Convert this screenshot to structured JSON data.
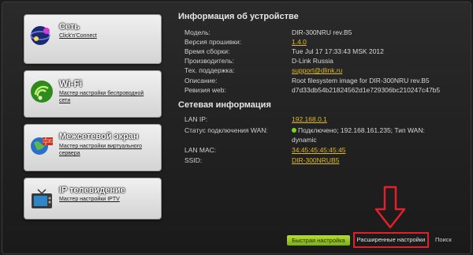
{
  "tiles": [
    {
      "title": "Сеть",
      "subtitle": "Click'n'Connect"
    },
    {
      "title": "Wi-Fi",
      "subtitle": "Мастер настройки беспроводной сети"
    },
    {
      "title": "Межсетевой экран",
      "subtitle": "Мастер настройки виртуального сервера"
    },
    {
      "title": "IP телевидение",
      "subtitle": "Мастер настройки IPTV"
    }
  ],
  "device_info": {
    "heading": "Информация об устройстве",
    "rows": [
      {
        "label": "Модель:",
        "value": "DIR-300NRU rev.B5"
      },
      {
        "label": "Версия прошивки:",
        "value": "1.4.0"
      },
      {
        "label": "Время сборки:",
        "value": "Tue Jul 17 17:33:43 MSK 2012"
      },
      {
        "label": "Производитель:",
        "value": "D-Link Russia"
      },
      {
        "label": "Тех. поддержка:",
        "value": "support@dlink.ru"
      },
      {
        "label": "Описание:",
        "value": "Root filesystem image for DIR-300NRU rev.B5"
      },
      {
        "label": "Ревизия web:",
        "value": "d7d33db54b21824562d1e729306bc210247c47b5"
      }
    ]
  },
  "network_info": {
    "heading": "Сетевая информация",
    "rows": [
      {
        "label": "LAN IP:",
        "value": "192.168.0.1"
      },
      {
        "label": "Статус подключения WAN:",
        "value": "Подключено; 192.168.161.235; Тип WAN:",
        "value2": "dynamic"
      },
      {
        "label": "LAN MAC:",
        "value": "34:45:45:45:45:45"
      },
      {
        "label": "SSID:",
        "value": "DIR-300NRUB5"
      }
    ]
  },
  "bottom": {
    "quick_label": "Быстрая настройка",
    "advanced_label": "Расширенные настройки",
    "search_label": "Поиск"
  },
  "colors": {
    "accent_red": "#e3202a",
    "link_yellow": "#e0b92a",
    "status_green": "#7cd321"
  }
}
